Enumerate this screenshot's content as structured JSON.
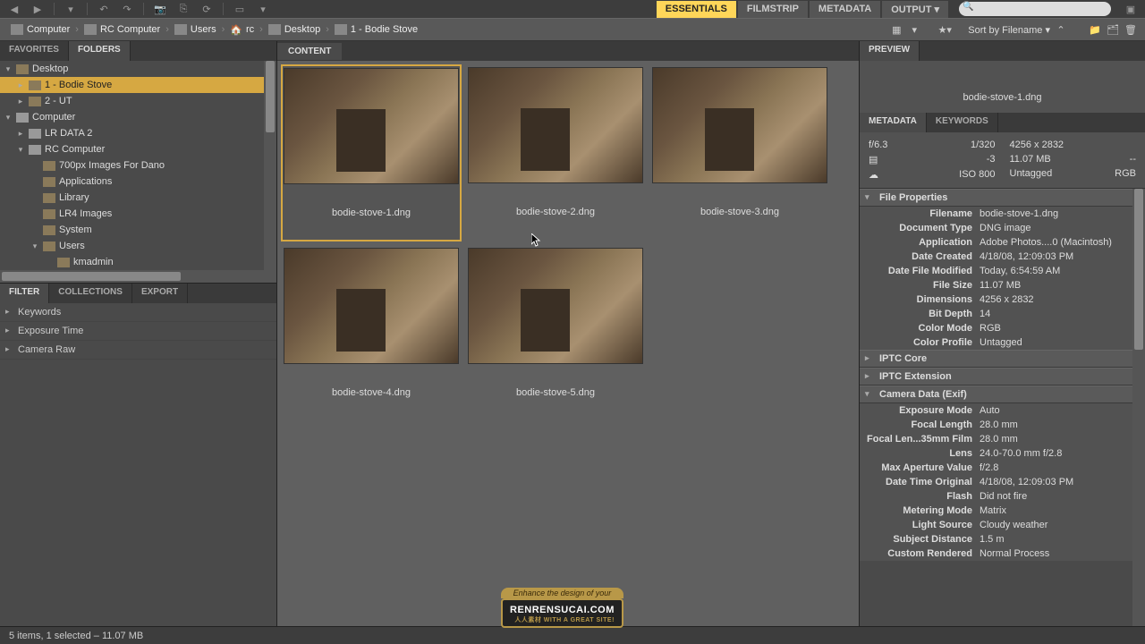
{
  "workspaces": [
    "ESSENTIALS",
    "FILMSTRIP",
    "METADATA",
    "OUTPUT"
  ],
  "active_workspace": "ESSENTIALS",
  "breadcrumb": [
    "Computer",
    "RC Computer",
    "Users",
    "rc",
    "Desktop",
    "1 - Bodie Stove"
  ],
  "sort_label": "Sort by Filename",
  "left_tabs": {
    "favorites": "FAVORITES",
    "folders": "FOLDERS"
  },
  "tree": [
    {
      "label": "Desktop",
      "indent": 0,
      "expanded": true,
      "icon": "folder"
    },
    {
      "label": "1 - Bodie Stove",
      "indent": 1,
      "selected": true,
      "icon": "folder"
    },
    {
      "label": "2 - UT",
      "indent": 1,
      "icon": "folder"
    },
    {
      "label": "Computer",
      "indent": 0,
      "expanded": true,
      "icon": "drive"
    },
    {
      "label": "LR DATA 2",
      "indent": 1,
      "icon": "drive"
    },
    {
      "label": "RC Computer",
      "indent": 1,
      "expanded": true,
      "icon": "drive"
    },
    {
      "label": "700px Images For Dano",
      "indent": 2,
      "icon": "folder"
    },
    {
      "label": "Applications",
      "indent": 2,
      "icon": "folder"
    },
    {
      "label": "Library",
      "indent": 2,
      "icon": "folder"
    },
    {
      "label": "LR4 Images",
      "indent": 2,
      "icon": "folder"
    },
    {
      "label": "System",
      "indent": 2,
      "icon": "folder"
    },
    {
      "label": "Users",
      "indent": 2,
      "expanded": true,
      "icon": "folder"
    },
    {
      "label": "kmadmin",
      "indent": 3,
      "icon": "folder"
    }
  ],
  "filter_tabs": {
    "filter": "FILTER",
    "collections": "COLLECTIONS",
    "export": "EXPORT"
  },
  "filter_items": [
    "Keywords",
    "Exposure Time",
    "Camera Raw"
  ],
  "content_tab": "CONTENT",
  "thumbnails": [
    {
      "name": "bodie-stove-1.dng",
      "selected": true
    },
    {
      "name": "bodie-stove-2.dng"
    },
    {
      "name": "bodie-stove-3.dng"
    },
    {
      "name": "bodie-stove-4.dng"
    },
    {
      "name": "bodie-stove-5.dng"
    }
  ],
  "preview_tab": "PREVIEW",
  "preview_filename": "bodie-stove-1.dng",
  "meta_tabs": {
    "metadata": "METADATA",
    "keywords": "KEYWORDS"
  },
  "summary": {
    "aperture": "f/6.3",
    "shutter": "1/320",
    "dimensions": "4256 x 2832",
    "ev": "-3",
    "size": "11.07 MB",
    "wb": "--",
    "iso": "ISO 800",
    "tag": "Untagged",
    "color": "RGB"
  },
  "sections": {
    "file_properties": {
      "title": "File Properties",
      "rows": [
        [
          "Filename",
          "bodie-stove-1.dng"
        ],
        [
          "Document Type",
          "DNG image"
        ],
        [
          "Application",
          "Adobe Photos....0 (Macintosh)"
        ],
        [
          "Date Created",
          "4/18/08, 12:09:03 PM"
        ],
        [
          "Date File Modified",
          "Today, 6:54:59 AM"
        ],
        [
          "File Size",
          "11.07 MB"
        ],
        [
          "Dimensions",
          "4256 x 2832"
        ],
        [
          "Bit Depth",
          "14"
        ],
        [
          "Color Mode",
          "RGB"
        ],
        [
          "Color Profile",
          "Untagged"
        ]
      ]
    },
    "iptc_core": {
      "title": "IPTC Core"
    },
    "iptc_ext": {
      "title": "IPTC Extension"
    },
    "camera_data": {
      "title": "Camera Data (Exif)",
      "rows": [
        [
          "Exposure Mode",
          "Auto"
        ],
        [
          "Focal Length",
          "28.0 mm"
        ],
        [
          "Focal Len...35mm Film",
          "28.0 mm"
        ],
        [
          "Lens",
          "24.0-70.0 mm f/2.8"
        ],
        [
          "Max Aperture Value",
          "f/2.8"
        ],
        [
          "Date Time Original",
          "4/18/08, 12:09:03 PM"
        ],
        [
          "Flash",
          "Did not fire"
        ],
        [
          "Metering Mode",
          "Matrix"
        ],
        [
          "Light Source",
          "Cloudy weather"
        ],
        [
          "Subject Distance",
          "1.5 m"
        ],
        [
          "Custom Rendered",
          "Normal Process"
        ]
      ]
    }
  },
  "status": "5 items, 1 selected – 11.07 MB",
  "watermark": {
    "top": "Enhance the design of your",
    "main": "RENRENSUCAI.COM",
    "sub": "人人素材 WITH A GREAT SITE!"
  }
}
